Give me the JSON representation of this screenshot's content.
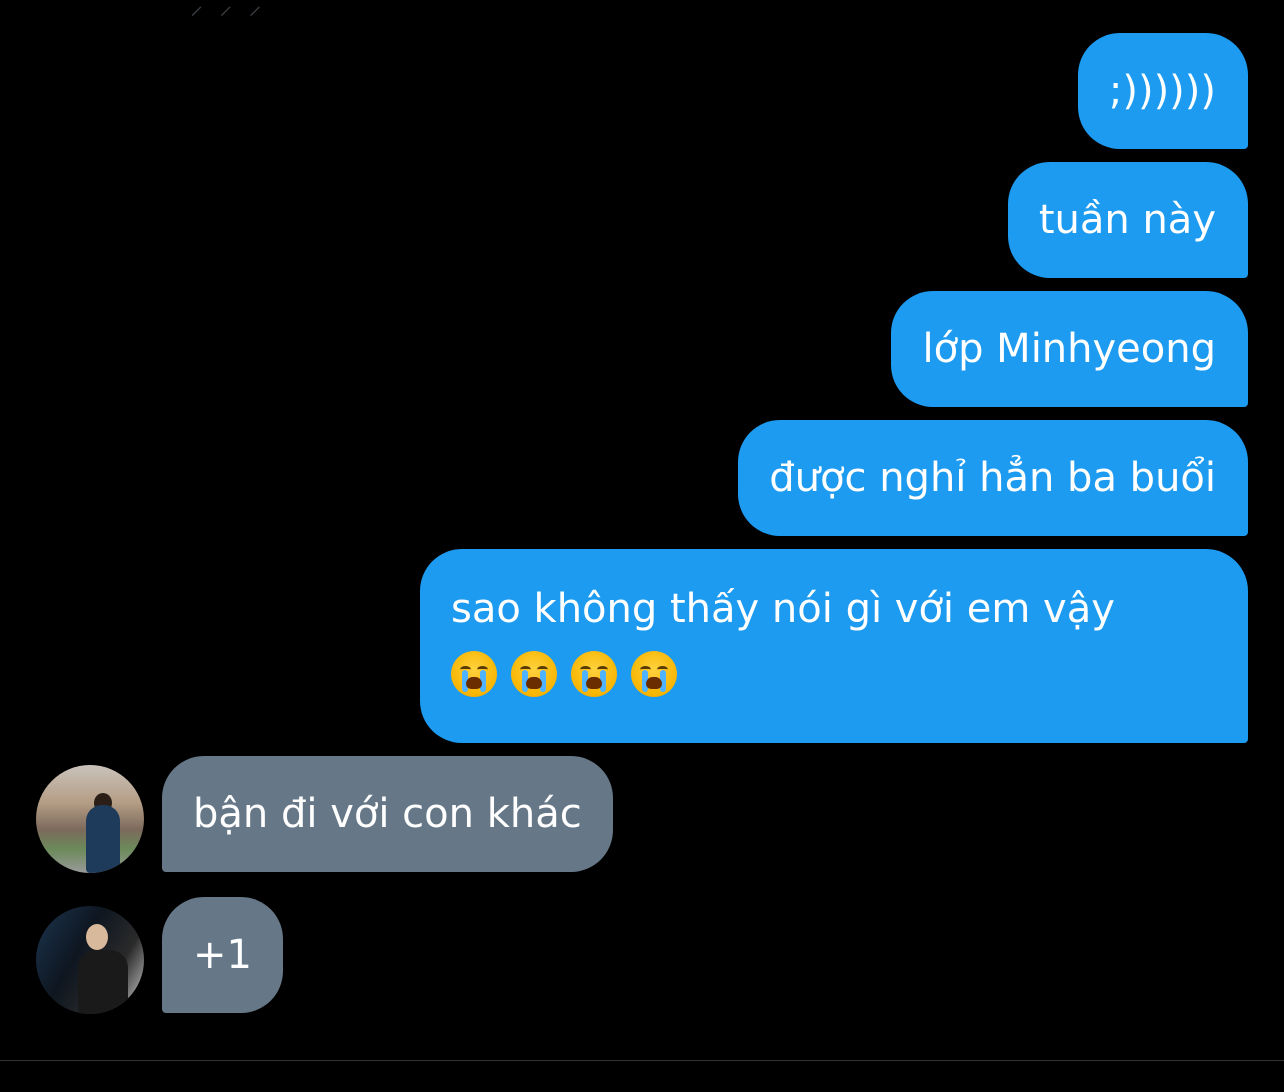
{
  "theme": {
    "background": "#000000",
    "outgoing_bubble": "#1d9bf0",
    "incoming_bubble": "#667787",
    "text": "#ffffff",
    "divider": "#2f3336"
  },
  "top_remnant": "⸝ ⸝ ⸝",
  "messages_out": [
    {
      "text": ";))))))"
    },
    {
      "text": "tuần này"
    },
    {
      "text": "lớp Minhyeong"
    },
    {
      "text": "được nghỉ hẳn ba buổi"
    },
    {
      "text": "sao không thấy nói gì với em vậy",
      "emojis": [
        "loudly-crying-face",
        "loudly-crying-face",
        "loudly-crying-face",
        "loudly-crying-face"
      ]
    }
  ],
  "messages_in": [
    {
      "text": "bận đi với con khác",
      "avatar": "avatar-user-1"
    },
    {
      "text": "+1",
      "avatar": "avatar-user-2"
    }
  ]
}
